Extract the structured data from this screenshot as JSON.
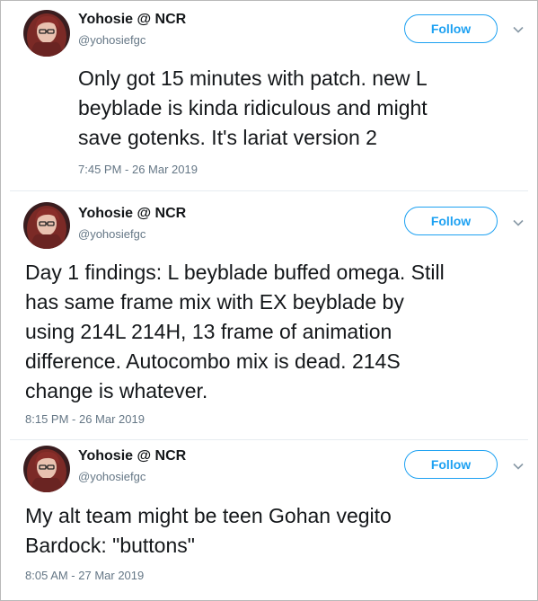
{
  "tweets": [
    {
      "display_name": "Yohosie @ NCR",
      "handle": "@yohosiefgc",
      "follow_label": "Follow",
      "text": "Only got 15 minutes with patch. new L\nbeyblade is kinda ridiculous and might\nsave gotenks. It's lariat version 2",
      "timestamp": "7:45 PM - 26 Mar 2019"
    },
    {
      "display_name": "Yohosie @ NCR",
      "handle": "@yohosiefgc",
      "follow_label": "Follow",
      "text": "Day 1 findings: L beyblade buffed omega. Still\nhas same frame mix with EX beyblade by\nusing 214L 214H, 13 frame of animation\ndifference. Autocombo mix is dead. 214S\nchange is whatever.",
      "timestamp": "8:15 PM - 26 Mar 2019"
    },
    {
      "display_name": "Yohosie @ NCR",
      "handle": "@yohosiefgc",
      "follow_label": "Follow",
      "text": "My alt team might be teen Gohan vegito\nBardock: \"buttons\"",
      "timestamp": "8:05 AM - 27 Mar 2019"
    }
  ],
  "colors": {
    "accent": "#1da1f2",
    "primary_text": "#14171a",
    "secondary_text": "#657786",
    "divider": "#e6ecf0"
  },
  "icons": {
    "menu": "chevron-down-icon",
    "avatar": "profile-photo"
  }
}
